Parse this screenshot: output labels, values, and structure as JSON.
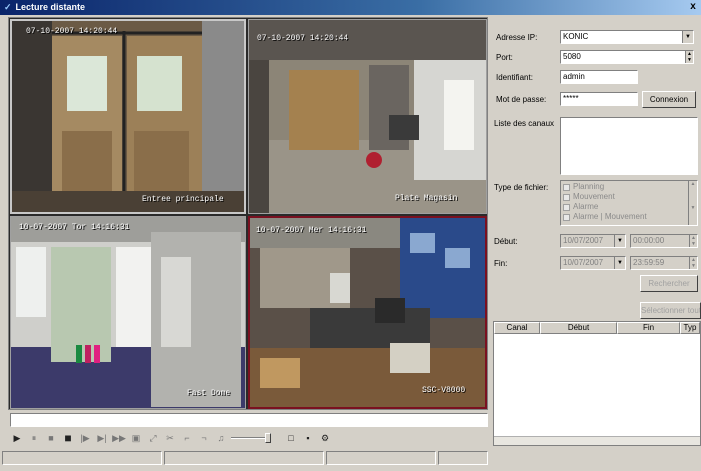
{
  "window": {
    "title": "Lecture distante",
    "close_glyph": "x"
  },
  "cameras": [
    {
      "timestamp": "07-10-2007 14:20:44",
      "label": "Entree principale"
    },
    {
      "timestamp": "07-10-2007 14:20:44",
      "label": "Plate Magasin"
    },
    {
      "timestamp": "10-07-2007 Tor 14:16:31",
      "label": "Fast Dome"
    },
    {
      "timestamp": "10-07-2007 Mer 14:16:31",
      "label": "SSC-V8000"
    }
  ],
  "form": {
    "ip_label": "Adresse IP:",
    "ip_value": "KONIC",
    "port_label": "Port:",
    "port_value": "5080",
    "user_label": "Identifiant:",
    "user_value": "admin",
    "pass_label": "Mot de passe:",
    "pass_value": "*****",
    "connect_label": "Connexion",
    "channels_label": "Liste des canaux",
    "filetype_label": "Type de fichier:",
    "filetypes": [
      "Planning",
      "Mouvement",
      "Alarme",
      "Alarme | Mouvement"
    ],
    "start_label": "Début:",
    "start_date": "10/07/2007",
    "start_time": "00:00:00",
    "end_label": "Fin:",
    "end_date": "10/07/2007",
    "end_time": "23:59:59",
    "search_label": "Rechercher",
    "select_all_label": "Sélectionner tout"
  },
  "results_table": {
    "columns": [
      "Canal",
      "Début",
      "Fin",
      "Typ"
    ]
  },
  "icons": {
    "play": "▶",
    "pause": "⏸",
    "stop": "■",
    "stop_all": "■",
    "frame": "|▶",
    "slow": "▶|",
    "fast": "▶▶",
    "snapshot": "▣",
    "zoom": "⤢",
    "cut": "✂",
    "clip_start": "⌐",
    "clip_end": "¬",
    "volume": "♫",
    "fullscreen": "□",
    "save": "▪",
    "settings": "⚙"
  },
  "colors": {
    "titlebar_start": "#0a246a",
    "titlebar_end": "#a6caf0",
    "cam_highlight": "#7a1020"
  }
}
